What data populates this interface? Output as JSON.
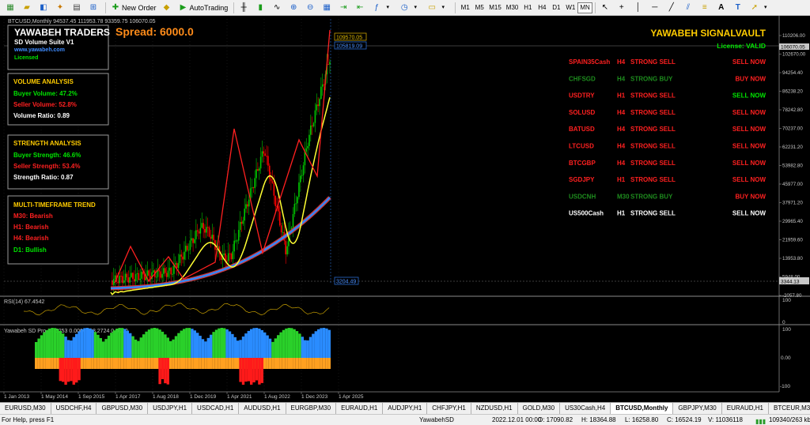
{
  "toolbar": {
    "new_order": "New Order",
    "auto_trading": "AutoTrading",
    "timeframes": [
      "M1",
      "M5",
      "M15",
      "M30",
      "H1",
      "H4",
      "D1",
      "W1",
      "MN"
    ],
    "active_timeframe": "MN"
  },
  "chart_header": "BTCUSD,Monthly  94537.45 111953.78 93359.75 106070.05",
  "broker_panel": {
    "title": "YAWABEH TRADERS",
    "product": "SD Volume Suite V1",
    "url": "www.yawabeh.com",
    "license": "Licensed"
  },
  "spread": "Spread: 6000.0",
  "volume_analysis": {
    "title": "VOLUME ANALYSIS",
    "buyer": "Buyer Volume: 47.2%",
    "seller": "Seller Volume: 52.8%",
    "ratio": "Volume Ratio: 0.89"
  },
  "strength_analysis": {
    "title": "STRENGTH ANALYSIS",
    "buyer": "Buyer Strength: 46.6%",
    "seller": "Seller Strength: 53.4%",
    "ratio": "Strength Ratio: 0.87"
  },
  "mtf_trend": {
    "title": "MULTI-TIMEFRAME TREND",
    "m30": "M30: Bearish",
    "h1": "H1: Bearish",
    "h4": "H4: Bearish",
    "d1": "D1: Bullish"
  },
  "signalvault": {
    "title": "YAWABEH SIGNALVAULT",
    "license": "License: VALID",
    "signals": [
      {
        "symbol": "SPAIN35Cash",
        "tf": "H4",
        "signal": "STRONG SELL",
        "action": "SELL NOW",
        "color": "#ff2020",
        "action_color": "#ff2020"
      },
      {
        "symbol": "CHFSGD",
        "tf": "H4",
        "signal": "STRONG BUY",
        "action": "BUY NOW",
        "color": "#1e8c1e",
        "action_color": "#ff2020"
      },
      {
        "symbol": "USDTRY",
        "tf": "H1",
        "signal": "STRONG SELL",
        "action": "SELL NOW",
        "color": "#ff2020",
        "action_color": "#00e600"
      },
      {
        "symbol": "SOLUSD",
        "tf": "H4",
        "signal": "STRONG SELL",
        "action": "SELL NOW",
        "color": "#ff2020",
        "action_color": "#ff2020"
      },
      {
        "symbol": "BATUSD",
        "tf": "H4",
        "signal": "STRONG SELL",
        "action": "SELL NOW",
        "color": "#ff2020",
        "action_color": "#ff2020"
      },
      {
        "symbol": "LTCUSD",
        "tf": "H4",
        "signal": "STRONG SELL",
        "action": "SELL NOW",
        "color": "#ff2020",
        "action_color": "#ff2020"
      },
      {
        "symbol": "BTCGBP",
        "tf": "H4",
        "signal": "STRONG SELL",
        "action": "SELL NOW",
        "color": "#ff2020",
        "action_color": "#ff2020"
      },
      {
        "symbol": "SGDJPY",
        "tf": "H1",
        "signal": "STRONG SELL",
        "action": "SELL NOW",
        "color": "#ff2020",
        "action_color": "#ff2020"
      },
      {
        "symbol": "USDCNH",
        "tf": "M30",
        "signal": "STRONG BUY",
        "action": "BUY NOW",
        "color": "#1e8c1e",
        "action_color": "#ff2020"
      },
      {
        "symbol": "US500Cash",
        "tf": "H1",
        "signal": "STRONG SELL",
        "action": "SELL NOW",
        "color": "#ffffff",
        "action_color": "#ffffff"
      }
    ]
  },
  "price_scale": [
    "110206.00",
    "102670.00",
    "94254.40",
    "86238.20",
    "78242.80",
    "70237.00",
    "62231.20",
    "53982.80",
    "45977.00",
    "37971.20",
    "29965.40",
    "21959.60",
    "13953.80",
    "5948.00",
    "-2057.80"
  ],
  "price_labels": {
    "high": "109570.05",
    "current": "105819.09",
    "bid": "106070.05",
    "level": "3344.13",
    "low_marker": "3204.49"
  },
  "rsi": {
    "label": "RSI(14) 67.4542",
    "top": "100",
    "bottom": "0"
  },
  "sd_pro": {
    "label": "Yawabeh SD Pro 38.5253 0.0000 -38.2724 0.0000",
    "scale": [
      "100",
      "0.00",
      "-100"
    ]
  },
  "time_axis": [
    "1 Jan 2013",
    "1 May 2014",
    "1 Sep 2015",
    "1 Apr 2017",
    "1 Aug 2018",
    "1 Dec 2019",
    "1 Apr 2021",
    "1 Aug 2022",
    "1 Dec 2023",
    "1 Apr 2025"
  ],
  "tabs": [
    "EURUSD,M30",
    "USDCHF,H4",
    "GBPUSD,M30",
    "USDJPY,H1",
    "USDCAD,H1",
    "AUDUSD,H1",
    "EURGBP,M30",
    "EURAUD,H1",
    "AUDJPY,H1",
    "CHFJPY,H1",
    "NZDUSD,H1",
    "GOLD,M30",
    "US30Cash,H4",
    "BTCUSD,Monthly",
    "GBPJPY,M30",
    "EURAUD,H1",
    "BTCEUR,M30"
  ],
  "active_tab": "BTCUSD,Monthly",
  "status": {
    "help": "For Help, press F1",
    "profile": "YawabehSD",
    "datetime": "2022.12.01 00:00",
    "open": "O: 17090.82",
    "high": "H: 18364.88",
    "low": "L: 16258.80",
    "close": "C: 16524.19",
    "volume": "V: 11036118",
    "traffic": "109340/263 kb"
  },
  "colors": {
    "bull": "#00c800",
    "bear": "#ff0000",
    "ma_fast": "#ffff33",
    "ma_slow_outer": "#cc3333",
    "ma_slow_inner": "#3388ff",
    "zigzag": "#ff2020",
    "title_gold": "#ffcc00",
    "spread_orange": "#ff8c1a"
  }
}
